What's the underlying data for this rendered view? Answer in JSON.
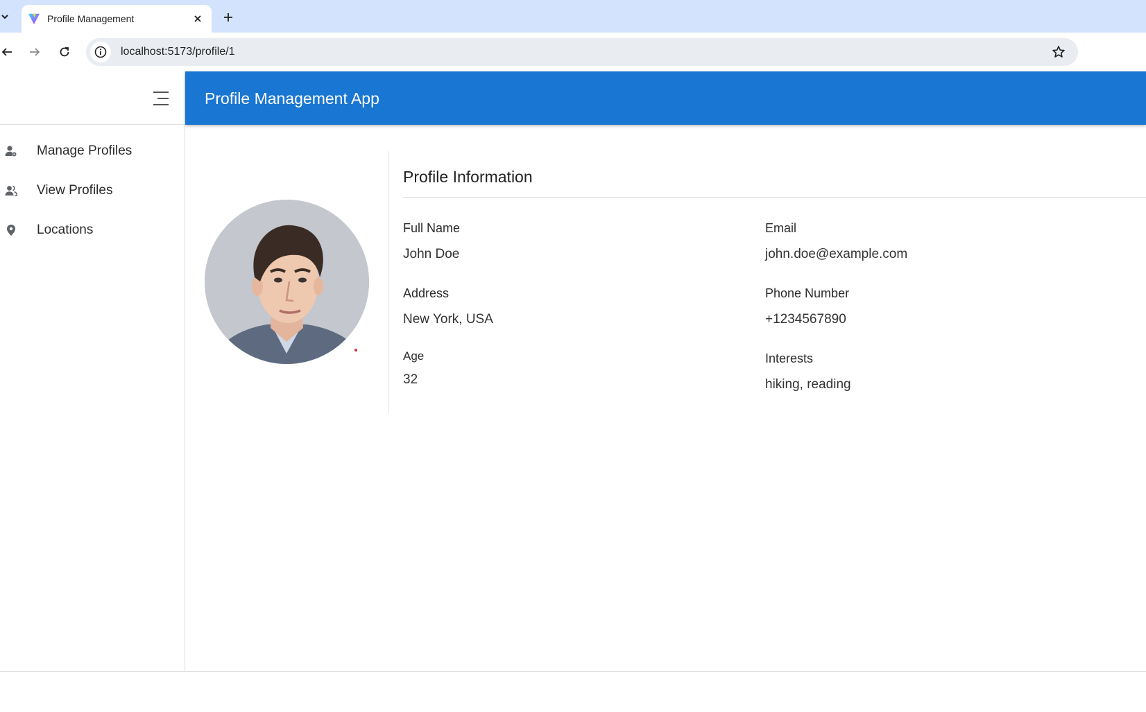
{
  "browser": {
    "tab_title": "Profile Management",
    "url": "localhost:5173/profile/1"
  },
  "app": {
    "title": "Profile Management App",
    "accent": "#1976d2"
  },
  "sidebar": {
    "items": [
      {
        "label": "Manage Profiles",
        "icon": "manage-profiles-icon"
      },
      {
        "label": "View Profiles",
        "icon": "people-icon"
      },
      {
        "label": "Locations",
        "icon": "location-pin-icon"
      }
    ]
  },
  "profile": {
    "section_title": "Profile Information",
    "fields": {
      "full_name": {
        "label": "Full Name",
        "value": "John Doe"
      },
      "email": {
        "label": "Email",
        "value": "john.doe@example.com"
      },
      "address": {
        "label": "Address",
        "value": "New York, USA"
      },
      "phone": {
        "label": "Phone Number",
        "value": "+1234567890"
      },
      "age": {
        "label": "Age",
        "value": "32"
      },
      "interests": {
        "label": "Interests",
        "value": "hiking, reading"
      }
    }
  }
}
